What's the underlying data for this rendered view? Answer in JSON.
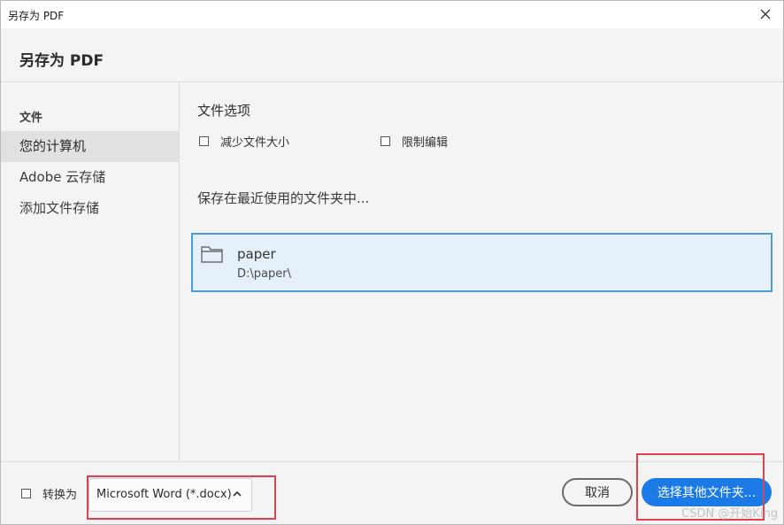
{
  "window": {
    "title": "另存为 PDF"
  },
  "header": {
    "title": "另存为 PDF"
  },
  "sidebar": {
    "section_label": "文件",
    "items": [
      {
        "label": "您的计算机",
        "active": true
      },
      {
        "label": "Adobe 云存储",
        "active": false
      },
      {
        "label": "添加文件存储",
        "active": false
      }
    ]
  },
  "main": {
    "options_heading": "文件选项",
    "options": [
      {
        "label": "减少文件大小",
        "checked": false
      },
      {
        "label": "限制编辑",
        "checked": false
      }
    ],
    "recent_heading": "保存在最近使用的文件夹中...",
    "recent_folders": [
      {
        "name": "paper",
        "path": "D:\\paper\\",
        "selected": true,
        "icon": "folder-icon"
      }
    ]
  },
  "footer": {
    "convert_label": "转换为",
    "convert_checked": false,
    "format_value": "Microsoft Word (*.docx)",
    "cancel_label": "取消",
    "choose_label": "选择其他文件夹..."
  },
  "watermark": "CSDN @开始King",
  "colors": {
    "accent": "#1c7ae6",
    "selection_bg": "#e6f0fb",
    "selection_border": "#4c9ad9",
    "annotation_red": "#e2404f"
  }
}
